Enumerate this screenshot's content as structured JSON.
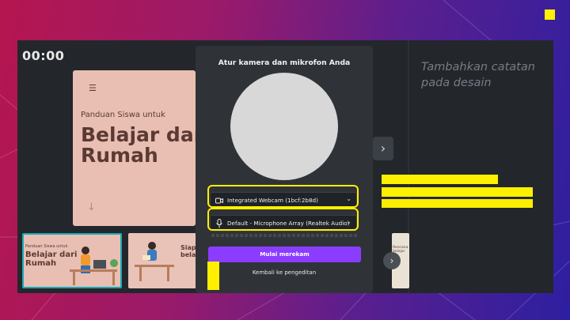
{
  "editor": {
    "timer": "00:00",
    "notes_placeholder": "Tambahkan catatan pada desain",
    "next_icon": "chevron-right-icon"
  },
  "slide": {
    "subtitle": "Panduan Siswa untuk",
    "title_line1": "Belajar dari",
    "title_line2": "Rumah",
    "menu_icon": "hamburger-icon",
    "arrow_icon": "arrow-down-icon",
    "background": "#e9bfb3",
    "text_color": "#5b3a33"
  },
  "thumbnails": {
    "items": [
      {
        "subtitle": "Panduan Siswa untuk",
        "title_line1": "Belajar dari",
        "title_line2": "Rumah",
        "selected": true
      },
      {
        "partial_line1": "Siapka",
        "partial_line2": "belaja"
      },
      {
        "partial_line1": "Rencana",
        "partial_line2": "belajar"
      }
    ],
    "nav_icon": "chevron-right-icon"
  },
  "setup": {
    "title": "Atur kamera dan mikrofon Anda",
    "camera_label": "Integrated Webcam (1bcf:2b8d)",
    "camera_icon": "camera-icon",
    "microphone_label": "Default - Microphone Array (Realtek Audio)",
    "microphone_icon": "microphone-icon",
    "record_button": "Mulai merekam",
    "back_link": "Kembali ke pengeditan"
  },
  "colors": {
    "accent_purple": "#8b3dff",
    "highlight_yellow": "#ffef00",
    "selection_teal": "#1aa9b9"
  }
}
